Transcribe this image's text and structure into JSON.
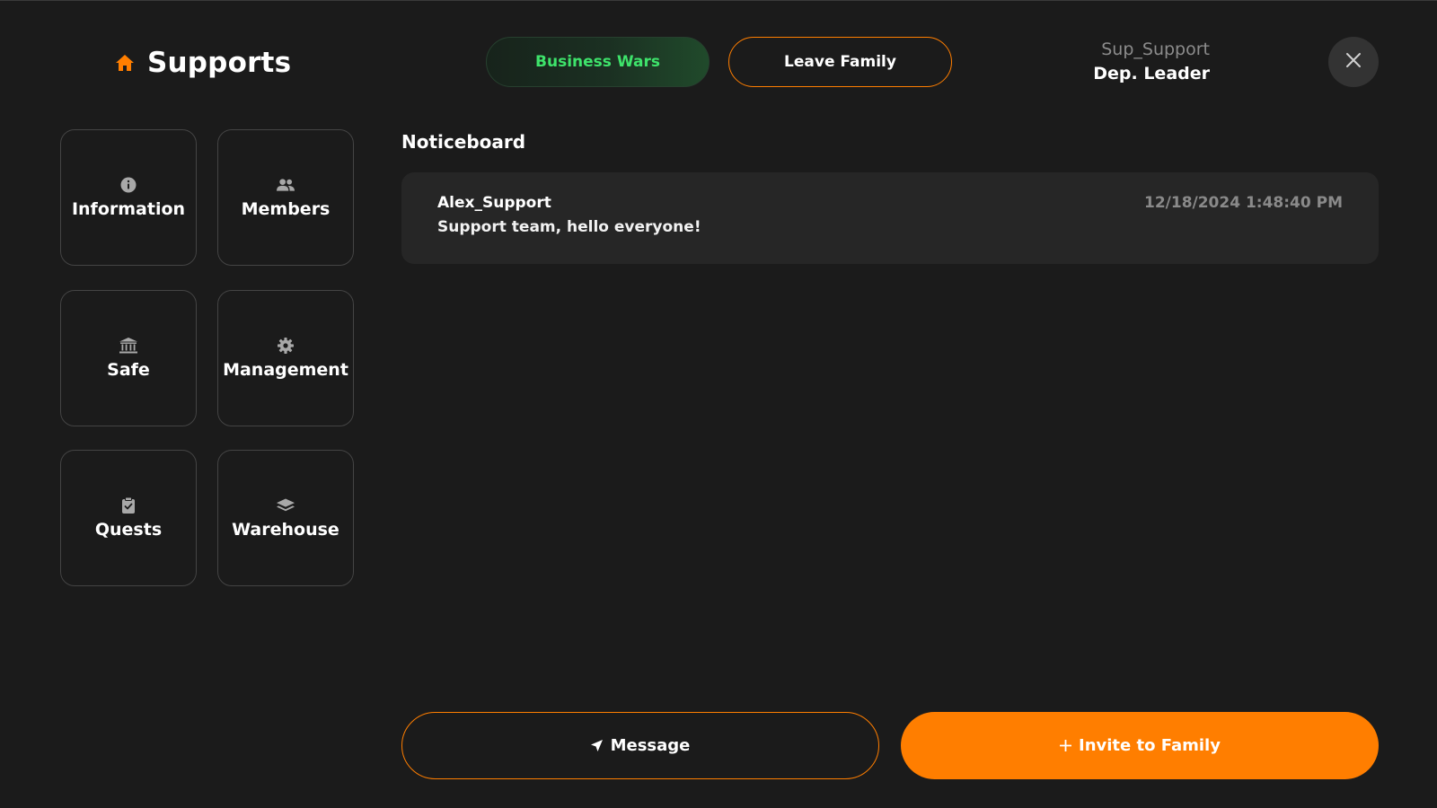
{
  "header": {
    "title": "Supports",
    "business_wars_label": "Business Wars",
    "leave_family_label": "Leave Family",
    "user_name": "Sup_Support",
    "user_role": "Dep. Leader"
  },
  "menu": {
    "items": [
      {
        "label": "Information",
        "icon": "info-icon"
      },
      {
        "label": "Members",
        "icon": "users-icon"
      },
      {
        "label": "Safe",
        "icon": "bank-icon"
      },
      {
        "label": "Management",
        "icon": "gear-icon"
      },
      {
        "label": "Quests",
        "icon": "clipboard-icon"
      },
      {
        "label": "Warehouse",
        "icon": "layers-icon"
      }
    ]
  },
  "noticeboard": {
    "title": "Noticeboard",
    "notices": [
      {
        "author": "Alex_Support",
        "text": "Support team, hello everyone!",
        "timestamp": "12/18/2024 1:48:40 PM"
      }
    ]
  },
  "actions": {
    "message_label": "Message",
    "invite_label": "Invite to Family"
  },
  "colors": {
    "accent": "#ff7e00",
    "background": "#1b1b1b",
    "success": "#3ee36b",
    "panel": "#262626"
  }
}
